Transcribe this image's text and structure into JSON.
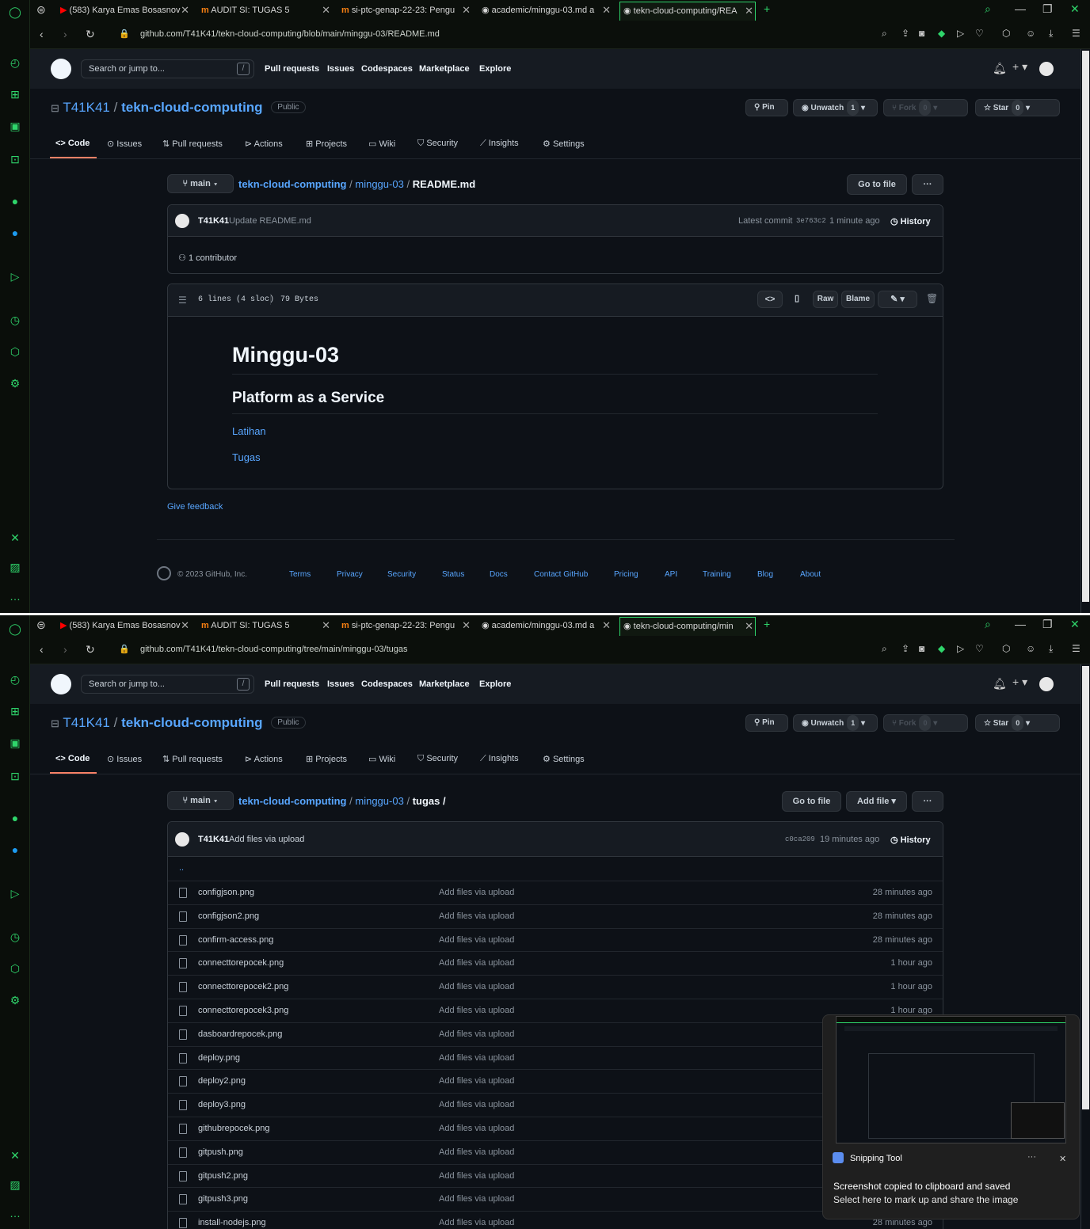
{
  "browser": {
    "tabs": [
      {
        "label": "(583) Karya Emas Bosasnov",
        "icon": "youtube-icon"
      },
      {
        "label": "AUDIT SI: TUGAS 5",
        "icon": "moodle-icon"
      },
      {
        "label": "si-ptc-genap-22-23: Pengu",
        "icon": "moodle-icon"
      },
      {
        "label": "academic/minggu-03.md a",
        "icon": "github-icon"
      },
      {
        "label": "tekn-cloud-computing/REA",
        "icon": "github-icon"
      }
    ],
    "tabs2_last": "tekn-cloud-computing/min",
    "url1": "github.com/T41K41/tekn-cloud-computing/blob/main/minggu-03/README.md",
    "url2": "github.com/T41K41/tekn-cloud-computing/tree/main/minggu-03/tugas"
  },
  "header": {
    "search_placeholder": "Search or jump to...",
    "slash": "/",
    "nav": [
      "Pull requests",
      "Issues",
      "Codespaces",
      "Marketplace",
      "Explore"
    ],
    "plus": "+"
  },
  "repo": {
    "owner": "T41K41",
    "sep": "/",
    "name": "tekn-cloud-computing",
    "visibility": "Public",
    "pin": "Pin",
    "unwatch": "Unwatch",
    "unwatch_count": "1",
    "fork": "Fork",
    "fork_count": "0",
    "star": "Star",
    "star_count": "0",
    "tabs": [
      "Code",
      "Issues",
      "Pull requests",
      "Actions",
      "Projects",
      "Wiki",
      "Security",
      "Insights",
      "Settings"
    ]
  },
  "pane1": {
    "branch": "main",
    "crumb_repo": "tekn-cloud-computing",
    "crumb_folder": "minggu-03",
    "crumb_file": "README.md",
    "goto_file": "Go to file",
    "more": "···",
    "commit_author": "T41K41",
    "commit_msg": "Update README.md",
    "latest_commit": "Latest commit",
    "commit_sha": "3e763c2",
    "commit_time": "1 minute ago",
    "history": "History",
    "contributors": "1 contributor",
    "lines": "6 lines (4 sloc)",
    "bytes": "79 Bytes",
    "raw": "Raw",
    "blame": "Blame",
    "md_h1": "Minggu-03",
    "md_h2": "Platform as a Service",
    "md_link1": "Latihan",
    "md_link2": "Tugas",
    "feedback": "Give feedback",
    "copyright": "© 2023 GitHub, Inc.",
    "footer_links": [
      "Terms",
      "Privacy",
      "Security",
      "Status",
      "Docs",
      "Contact GitHub",
      "Pricing",
      "API",
      "Training",
      "Blog",
      "About"
    ]
  },
  "pane2": {
    "branch": "main",
    "crumb_repo": "tekn-cloud-computing",
    "crumb_folder": "minggu-03",
    "crumb_sub": "tugas",
    "goto_file": "Go to file",
    "add_file": "Add file",
    "more": "···",
    "commit_author": "T41K41",
    "commit_msg": "Add files via upload",
    "commit_sha": "c0ca209",
    "commit_time": "19 minutes ago",
    "history": "History",
    "parent": "..",
    "files": [
      {
        "name": "configjson.png",
        "msg": "Add files via upload",
        "time": "28 minutes ago"
      },
      {
        "name": "configjson2.png",
        "msg": "Add files via upload",
        "time": "28 minutes ago"
      },
      {
        "name": "confirm-access.png",
        "msg": "Add files via upload",
        "time": "28 minutes ago"
      },
      {
        "name": "connecttorepocek.png",
        "msg": "Add files via upload",
        "time": "1 hour ago"
      },
      {
        "name": "connecttorepocek2.png",
        "msg": "Add files via upload",
        "time": "1 hour ago"
      },
      {
        "name": "connecttorepocek3.png",
        "msg": "Add files via upload",
        "time": "1 hour ago"
      },
      {
        "name": "dasboardrepocek.png",
        "msg": "Add files via upload",
        "time": ""
      },
      {
        "name": "deploy.png",
        "msg": "Add files via upload",
        "time": ""
      },
      {
        "name": "deploy2.png",
        "msg": "Add files via upload",
        "time": ""
      },
      {
        "name": "deploy3.png",
        "msg": "Add files via upload",
        "time": ""
      },
      {
        "name": "githubrepocek.png",
        "msg": "Add files via upload",
        "time": ""
      },
      {
        "name": "gitpush.png",
        "msg": "Add files via upload",
        "time": ""
      },
      {
        "name": "gitpush2.png",
        "msg": "Add files via upload",
        "time": ""
      },
      {
        "name": "gitpush3.png",
        "msg": "Add files via upload",
        "time": ""
      },
      {
        "name": "install-nodejs.png",
        "msg": "Add files via upload",
        "time": "28 minutes ago"
      }
    ]
  },
  "toast": {
    "app": "Snipping Tool",
    "title": "Screenshot copied to clipboard and saved",
    "body": "Select here to mark up and share the image",
    "more": "···",
    "close": "✕"
  }
}
